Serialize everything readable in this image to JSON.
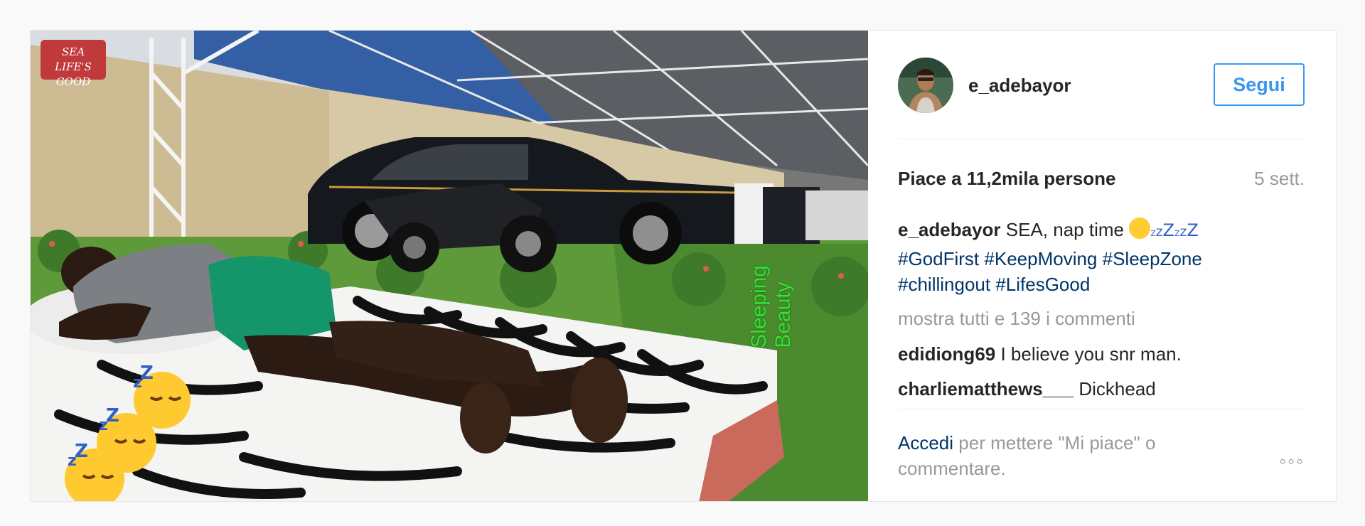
{
  "post": {
    "watermark": {
      "line1": "SEA",
      "line2": "LIFE'S GOOD"
    },
    "photo_overlay_text": {
      "line1": "Sleeping",
      "line2": "Beauty"
    },
    "username": "e_adebayor",
    "follow_label": "Segui",
    "likes_text": "Piace a 11,2mila persone",
    "time_ago": "5 sett.",
    "caption": {
      "user": "e_adebayor",
      "text": "SEA, nap time",
      "zz": "zzzz",
      "hashtags": [
        "#GodFirst",
        "#KeepMoving",
        "#SleepZone",
        "#chillingout",
        "#LifesGood"
      ]
    },
    "view_all_comments": "mostra tutti e 139 i commenti",
    "comments": [
      {
        "user": "edidiong69",
        "text": "I believe you snr man."
      },
      {
        "user": "charliematthews___",
        "text": "Dickhead"
      }
    ],
    "login_prompt": {
      "link": "Accedi",
      "text": "per mettere \"Mi piace\" o commentare."
    },
    "more_label": "◦◦◦",
    "colors": {
      "accent": "#3897f0",
      "link": "#003569",
      "muted": "#999999"
    }
  }
}
